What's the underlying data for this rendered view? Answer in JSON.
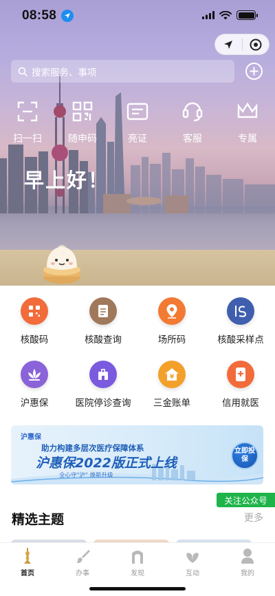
{
  "status_bar": {
    "time": "08:58"
  },
  "search": {
    "placeholder": "搜索服务、事项"
  },
  "quick_actions": [
    {
      "label": "扫一扫",
      "icon": "scan-icon"
    },
    {
      "label": "随申码",
      "icon": "qr-code-icon"
    },
    {
      "label": "亮证",
      "icon": "id-card-icon"
    },
    {
      "label": "客服",
      "icon": "headset-icon"
    },
    {
      "label": "专属",
      "icon": "crown-icon"
    }
  ],
  "greeting": "早上好！",
  "services": [
    {
      "label": "核酸码",
      "icon": "qr-code-icon",
      "color": "#f26b3a"
    },
    {
      "label": "核酸查询",
      "icon": "document-icon",
      "color": "#a0785a"
    },
    {
      "label": "场所码",
      "icon": "location-pin-icon",
      "color": "#f27a32"
    },
    {
      "label": "核酸采样点",
      "icon": "sampling-site-icon",
      "color": "#3f5fae"
    },
    {
      "label": "沪惠保",
      "icon": "lotus-icon",
      "color": "#8a63d8"
    },
    {
      "label": "医院停诊查询",
      "icon": "hospital-icon",
      "color": "#7a5be0"
    },
    {
      "label": "三金账单",
      "icon": "house-yuan-icon",
      "color": "#f3a02a"
    },
    {
      "label": "信用就医",
      "icon": "phone-medical-icon",
      "color": "#f26b3a"
    }
  ],
  "banner": {
    "brand": "沪惠保",
    "line1": "助力构建多层次医疗保障体系",
    "line2": "沪惠保2022版正式上线",
    "line3": "全心守\"沪\"  焕新升级",
    "cta": "立即投保"
  },
  "follow_label": "关注公众号",
  "section": {
    "title": "精选主题",
    "more": "更多"
  },
  "tabs": [
    {
      "label": "首页",
      "icon": "pagoda-icon",
      "active": true
    },
    {
      "label": "办事",
      "icon": "brush-icon",
      "active": false
    },
    {
      "label": "发现",
      "icon": "gate-icon",
      "active": false
    },
    {
      "label": "互动",
      "icon": "hands-icon",
      "active": false
    },
    {
      "label": "我的",
      "icon": "person-icon",
      "active": false
    }
  ]
}
